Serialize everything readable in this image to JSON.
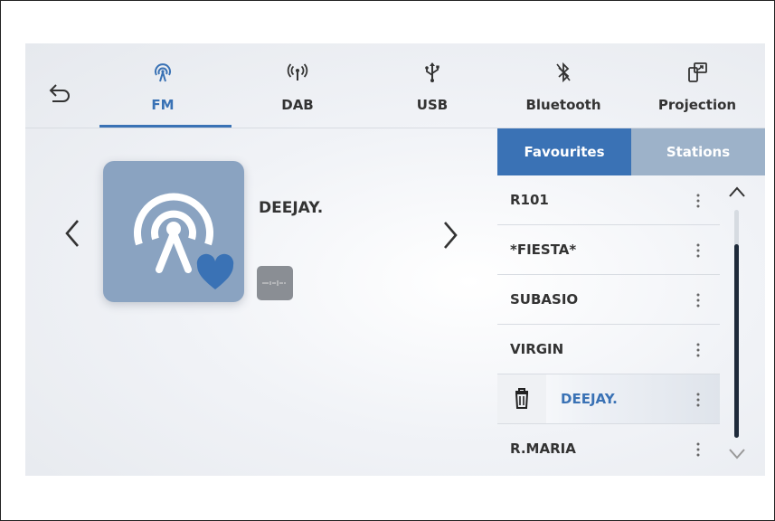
{
  "tabs": [
    {
      "label": "FM",
      "icon": "radio-signal-icon",
      "active": true
    },
    {
      "label": "DAB",
      "icon": "broadcast-antenna-icon",
      "active": false
    },
    {
      "label": "USB",
      "icon": "usb-icon",
      "active": false
    },
    {
      "label": "Bluetooth",
      "icon": "bluetooth-icon",
      "active": false
    },
    {
      "label": "Projection",
      "icon": "phone-projection-icon",
      "active": false
    }
  ],
  "now_playing": {
    "station_name": "DEEJAY.",
    "favourite": true
  },
  "panel": {
    "tabs": [
      {
        "label": "Favourites",
        "active": true
      },
      {
        "label": "Stations",
        "active": false
      }
    ],
    "stations": [
      {
        "label": "R101"
      },
      {
        "label": "*FIESTA*"
      },
      {
        "label": "SUBASIO"
      },
      {
        "label": "VIRGIN"
      },
      {
        "label": "DEEJAY.",
        "selected": true
      },
      {
        "label": "R.MARIA"
      }
    ]
  },
  "colors": {
    "accent": "#3a72b5",
    "inactive_tab": "#9db2c9",
    "artwork": "#8aa3c1"
  }
}
